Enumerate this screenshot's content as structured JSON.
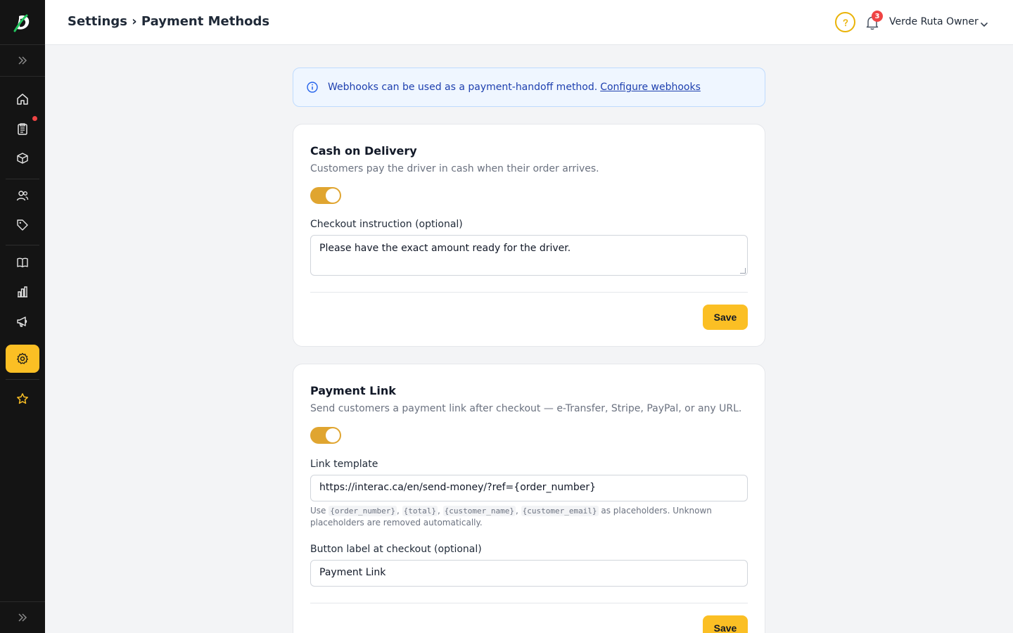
{
  "header": {
    "breadcrumb": "Settings › Payment Methods",
    "user_name": "Verde Ruta Owner",
    "notification_count": "3"
  },
  "sidebar": {
    "items": [
      "home",
      "orders",
      "products",
      "customers",
      "tags",
      "catalog",
      "reports",
      "marketing",
      "settings",
      "favorites"
    ],
    "active": "settings",
    "accent_color": "#fbbf24"
  },
  "banner": {
    "text": "Webhooks can be used as a payment-handoff method.",
    "link": "Configure webhooks"
  },
  "cash_on_delivery": {
    "title": "Cash on Delivery",
    "subtitle": "Customers pay the driver in cash when their order arrives.",
    "enabled": true,
    "instruction_label": "Checkout instruction (optional)",
    "instruction_value": "Please have the exact amount ready for the driver.",
    "save_label": "Save"
  },
  "payment_link": {
    "title": "Payment Link",
    "subtitle": "Send customers a payment link after checkout — e-Transfer, Stripe, PayPal, or any URL.",
    "enabled": true,
    "template_label": "Link template",
    "template_value": "https://interac.ca/en/send-money/?ref={order_number}",
    "hint_use": "Use",
    "placeholders": [
      "{order_number}",
      "{total}",
      "{customer_name}",
      "{customer_email}"
    ],
    "hint_rest": "as placeholders. Unknown placeholders are removed automatically.",
    "button_label_label": "Button label at checkout (optional)",
    "button_label_value": "Payment Link",
    "save_label": "Save"
  }
}
